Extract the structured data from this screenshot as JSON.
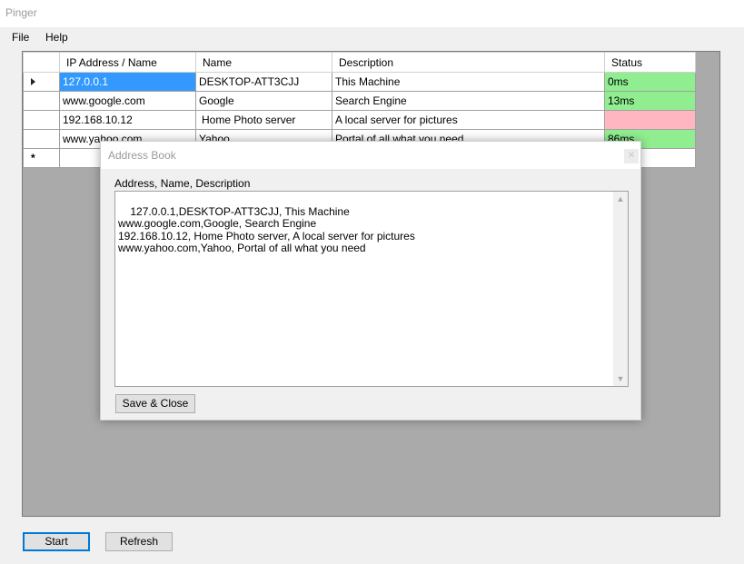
{
  "window": {
    "title": "Pinger"
  },
  "menu": {
    "file": "File",
    "help": "Help"
  },
  "grid": {
    "headers": {
      "ip": "IP Address / Name",
      "name": "Name",
      "description": "Description",
      "status": "Status"
    },
    "rows": [
      {
        "ip": "127.0.0.1",
        "name": "DESKTOP-ATT3CJJ",
        "description": "This Machine",
        "status": "0ms",
        "status_color": "#90ee90"
      },
      {
        "ip": "www.google.com",
        "name": "Google",
        "description": "Search Engine",
        "status": "13ms",
        "status_color": "#90ee90"
      },
      {
        "ip": "192.168.10.12",
        "name": "Home Photo server",
        "description": "A local server for pictures",
        "status": "",
        "status_color": "#ffb6c1"
      },
      {
        "ip": "www.yahoo.com",
        "name": "Yahoo",
        "description": "Portal of all what you need",
        "status": "86ms",
        "status_color": "#90ee90"
      }
    ],
    "new_row_marker": "*"
  },
  "dialog": {
    "title": "Address Book",
    "label": "Address, Name, Description",
    "content": "127.0.0.1,DESKTOP-ATT3CJJ, This Machine\nwww.google.com,Google, Search Engine\n192.168.10.12, Home Photo server, A local server for pictures\nwww.yahoo.com,Yahoo, Portal of all what you need",
    "save_close": "Save & Close"
  },
  "buttons": {
    "start": "Start",
    "refresh": "Refresh"
  },
  "colors": {
    "selection": "#3399ff",
    "ok": "#90ee90",
    "fail": "#ffb6c1",
    "grid_background": "#aaaaaa"
  }
}
